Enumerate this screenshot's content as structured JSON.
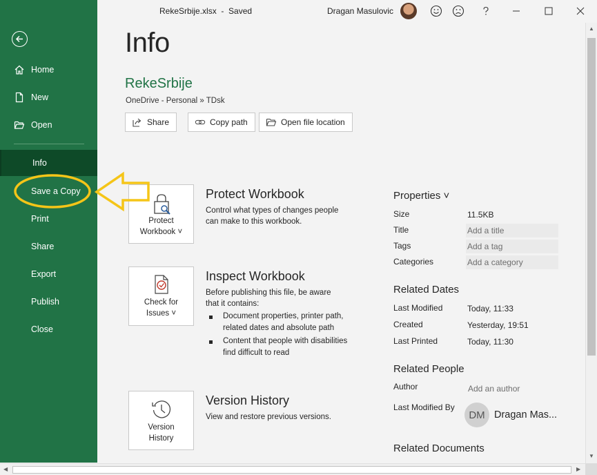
{
  "titlebar": {
    "doc_title": "RekeSrbije.xlsx  -  Saved",
    "user_name": "Dragan Masulovic"
  },
  "sidebar": {
    "items": [
      {
        "label": "Home",
        "icon": "home-icon"
      },
      {
        "label": "New",
        "icon": "new-document-icon"
      },
      {
        "label": "Open",
        "icon": "folder-open-icon"
      },
      {
        "label": "Info"
      },
      {
        "label": "Save a Copy"
      },
      {
        "label": "Print"
      },
      {
        "label": "Share"
      },
      {
        "label": "Export"
      },
      {
        "label": "Publish"
      },
      {
        "label": "Close"
      }
    ],
    "active": "Info",
    "colors": {
      "background": "#217346",
      "active": "#0e4a28"
    }
  },
  "main": {
    "title": "Info",
    "file_name": "RekeSrbije",
    "file_path": "OneDrive - Personal » TDsk",
    "actions": {
      "share": "Share",
      "copy_path": "Copy path",
      "open_location": "Open file location"
    },
    "protect": {
      "card_line1": "Protect",
      "card_line2": "Workbook ˅",
      "title": "Protect Workbook",
      "desc": "Control what types of changes people can make to this workbook."
    },
    "inspect": {
      "card_line1": "Check for",
      "card_line2": "Issues ˅",
      "title": "Inspect Workbook",
      "desc": "Before publishing this file, be aware that it contains:",
      "bullets": [
        "Document properties, printer path, related dates and absolute path",
        "Content that people with disabilities find difficult to read"
      ]
    },
    "version": {
      "card_line1": "Version",
      "card_line2": "History",
      "title": "Version History",
      "desc": "View and restore previous versions."
    }
  },
  "properties": {
    "heading": "Properties ˅",
    "size_label": "Size",
    "size_value": "11.5KB",
    "title_label": "Title",
    "title_placeholder": "Add a title",
    "tags_label": "Tags",
    "tags_placeholder": "Add a tag",
    "categories_label": "Categories",
    "categories_placeholder": "Add a category",
    "dates_heading": "Related Dates",
    "last_modified_label": "Last Modified",
    "last_modified_value": "Today, 11:33",
    "created_label": "Created",
    "created_value": "Yesterday, 19:51",
    "last_printed_label": "Last Printed",
    "last_printed_value": "Today, 11:30",
    "people_heading": "Related People",
    "author_label": "Author",
    "author_placeholder": "Add an author",
    "last_modified_by_label": "Last Modified By",
    "modifier_initials": "DM",
    "modifier_name": "Dragan Mas...",
    "documents_heading": "Related Documents"
  },
  "annotation": {
    "color": "#f5c518",
    "highlight": "Save a Copy"
  }
}
